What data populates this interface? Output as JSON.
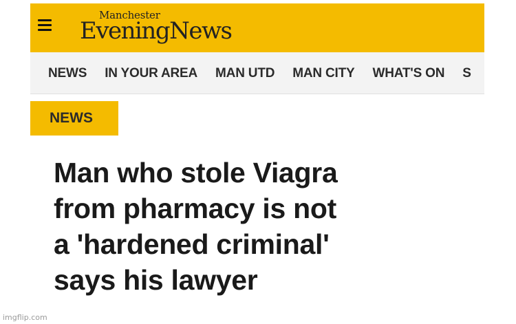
{
  "header": {
    "logo_top": "Manchester",
    "logo_main": "EveningNews",
    "menu_icon": "hamburger-menu-icon",
    "background_color": "#f4bb00"
  },
  "nav": {
    "items": [
      "NEWS",
      "IN YOUR AREA",
      "MAN UTD",
      "MAN CITY",
      "WHAT'S ON",
      "S"
    ]
  },
  "article": {
    "section_label": "NEWS",
    "headline_lines": [
      "Man who stole Viagra",
      "from pharmacy is not",
      "a 'hardened criminal'",
      "says his lawyer"
    ]
  },
  "watermark": "imgflip.com"
}
